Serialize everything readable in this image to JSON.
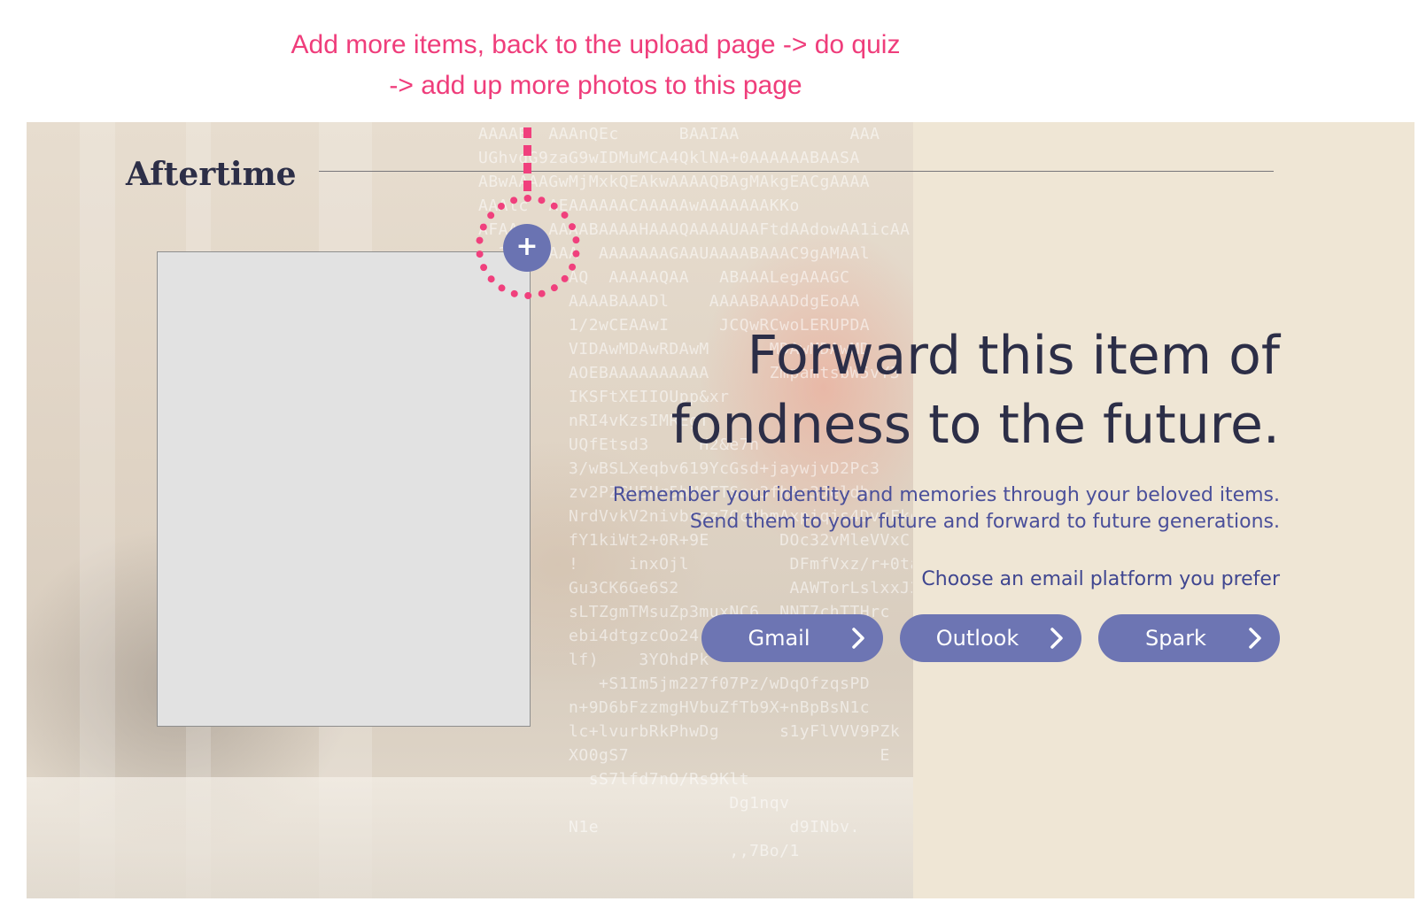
{
  "annotation": {
    "line1": "Add more items, back to the upload page -> do quiz",
    "line2": "-> add up more photos to this page",
    "color": "#ef3d7b"
  },
  "header": {
    "brand": "Aftertime"
  },
  "upload": {
    "add_button_label": "+",
    "add_icon": "plus-icon"
  },
  "main": {
    "headline_line1": "Forward this item of",
    "headline_line2": "fondness to the future.",
    "subtext_line1": "Remember your identity and memories through your beloved items.",
    "subtext_line2": "Send them to your future and forward to future generations.",
    "platform_prompt": "Choose an email platform you prefer"
  },
  "platforms": [
    {
      "label": "Gmail",
      "icon": "chevron-right-icon"
    },
    {
      "label": "Outlook",
      "icon": "chevron-right-icon"
    },
    {
      "label": "Spark",
      "icon": "chevron-right-icon"
    }
  ],
  "colors": {
    "accent": "#6d75b3",
    "text_dark": "#2c2e47",
    "text_blue": "#4a4f9a",
    "panel_bg": "#efe6d5",
    "annotation_pink": "#ef3d7b"
  }
}
